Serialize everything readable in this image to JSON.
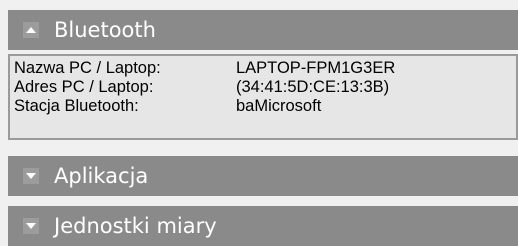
{
  "sections": {
    "bluetooth": {
      "title": "Bluetooth",
      "expanded": true,
      "rows": [
        {
          "label": "Nazwa PC / Laptop:",
          "value": "LAPTOP-FPM1G3ER"
        },
        {
          "label": "Adres PC / Laptop:",
          "value": "(34:41:5D:CE:13:3B)"
        },
        {
          "label": "Stacja Bluetooth:",
          "value": "baMicrosoft"
        }
      ]
    },
    "aplikacja": {
      "title": "Aplikacja",
      "expanded": false
    },
    "jednostki": {
      "title": "Jednostki miary",
      "expanded": false
    }
  },
  "icons": {
    "expanded": "chevron-up-icon",
    "collapsed": "chevron-down-icon"
  },
  "colors": {
    "header_bg": "#8a8a8a",
    "header_text": "#ffffff",
    "content_bg": "#e6e6e6",
    "content_border": "#9a9a9a"
  }
}
